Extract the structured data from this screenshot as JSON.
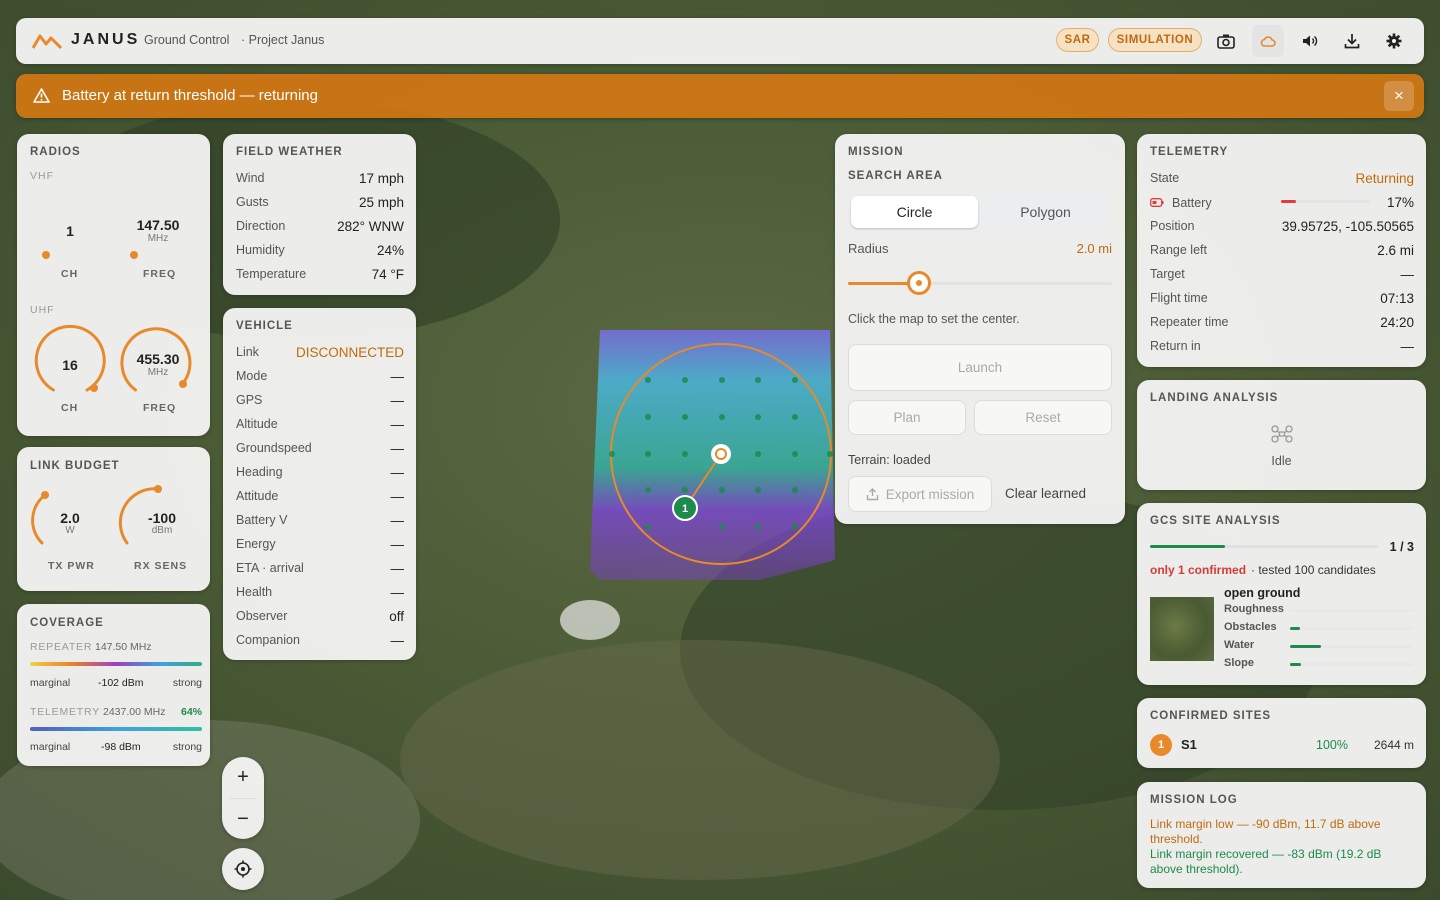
{
  "header": {
    "brand": "JANUS",
    "app": "Ground Control",
    "project": "· Project Janus",
    "pill_sar": "SAR",
    "pill_sim": "SIMULATION"
  },
  "colors": {
    "accent": "#e8892b",
    "green": "#1e8a4c",
    "red": "#e03c3c"
  },
  "alert": {
    "text": "Battery at return threshold — returning",
    "close": "×"
  },
  "radios": {
    "title": "RADIOS",
    "vhf": "VHF",
    "uhf": "UHF",
    "vhf_ch": "1",
    "vhf_freq": "147.50",
    "uhf_ch": "16",
    "uhf_freq": "455.30",
    "unit_mhz": "MHz",
    "ch": "CH",
    "freq": "FREQ"
  },
  "link_budget": {
    "title": "LINK BUDGET",
    "tx": "2.0",
    "tx_unit": "W",
    "tx_label": "TX PWR",
    "rx": "-100",
    "rx_unit": "dBm",
    "rx_label": "RX SENS"
  },
  "coverage": {
    "title": "COVERAGE",
    "rep_label": "REPEATER",
    "rep_freq": "147.50 MHz",
    "tel_label": "TELEMETRY",
    "tel_freq": "2437.00 MHz",
    "tel_pct": "64%",
    "marginal": "marginal",
    "strong": "strong",
    "rep_dbm": "-102 dBm",
    "tel_dbm": "-98 dBm"
  },
  "weather": {
    "title": "FIELD WEATHER",
    "rows": [
      [
        "Wind",
        "17 mph"
      ],
      [
        "Gusts",
        "25 mph"
      ],
      [
        "Direction",
        "282° WNW"
      ],
      [
        "Humidity",
        "24%"
      ],
      [
        "Temperature",
        "74 °F"
      ]
    ]
  },
  "vehicle": {
    "title": "VEHICLE",
    "link_label": "Link",
    "link_value": "DISCONNECTED",
    "rows": [
      [
        "Mode",
        "—"
      ],
      [
        "GPS",
        "—"
      ],
      [
        "Altitude",
        "—"
      ],
      [
        "Groundspeed",
        "—"
      ],
      [
        "Heading",
        "—"
      ],
      [
        "Attitude",
        "—"
      ],
      [
        "Battery V",
        "—"
      ],
      [
        "Energy",
        "—"
      ],
      [
        "ETA · arrival",
        "—"
      ],
      [
        "Health",
        "—"
      ],
      [
        "Observer",
        "off"
      ],
      [
        "Companion",
        "—"
      ]
    ]
  },
  "mission": {
    "title": "MISSION",
    "search_area": "SEARCH AREA",
    "circle": "Circle",
    "polygon": "Polygon",
    "radius_label": "Radius",
    "radius_value": "2.0 mi",
    "hint": "Click the map to set the center.",
    "launch": "Launch",
    "plan": "Plan",
    "reset": "Reset",
    "terrain": "Terrain: loaded",
    "export": "Export mission",
    "clear": "Clear learned",
    "radius_fraction": 0.27
  },
  "telemetry": {
    "title": "TELEMETRY",
    "state_label": "State",
    "state_value": "Returning",
    "battery_label": "Battery",
    "battery_value": "17%",
    "battery_fraction": 0.17,
    "rows": [
      [
        "Position",
        "39.95725, -105.50565"
      ],
      [
        "Range left",
        "2.6 mi"
      ],
      [
        "Target",
        "—"
      ],
      [
        "Flight time",
        "07:13"
      ],
      [
        "Repeater time",
        "24:20"
      ],
      [
        "Return in",
        "—"
      ]
    ]
  },
  "landing": {
    "title": "LANDING ANALYSIS",
    "status": "Idle"
  },
  "gcs": {
    "title": "GCS SITE ANALYSIS",
    "count": "1 / 3",
    "progress": 0.33,
    "warn": "only 1 confirmed",
    "tested": "· tested 100 candidates",
    "site_type": "open ground",
    "metrics": [
      {
        "name": "Roughness",
        "value": 0.0
      },
      {
        "name": "Obstacles",
        "value": 0.08
      },
      {
        "name": "Water",
        "value": 0.25
      },
      {
        "name": "Slope",
        "value": 0.09
      }
    ]
  },
  "sites": {
    "title": "CONFIRMED SITES",
    "num": "1",
    "name": "S1",
    "pct": "100%",
    "dist": "2644 m"
  },
  "log": {
    "title": "MISSION LOG",
    "entry1": "Link margin low — -90 dBm, 11.7 dB above threshold.",
    "entry2": "Link margin recovered — -83 dBm (19.2 dB above threshold)."
  },
  "map": {
    "zoom_in": "+",
    "zoom_out": "−",
    "waypoint": "1"
  }
}
